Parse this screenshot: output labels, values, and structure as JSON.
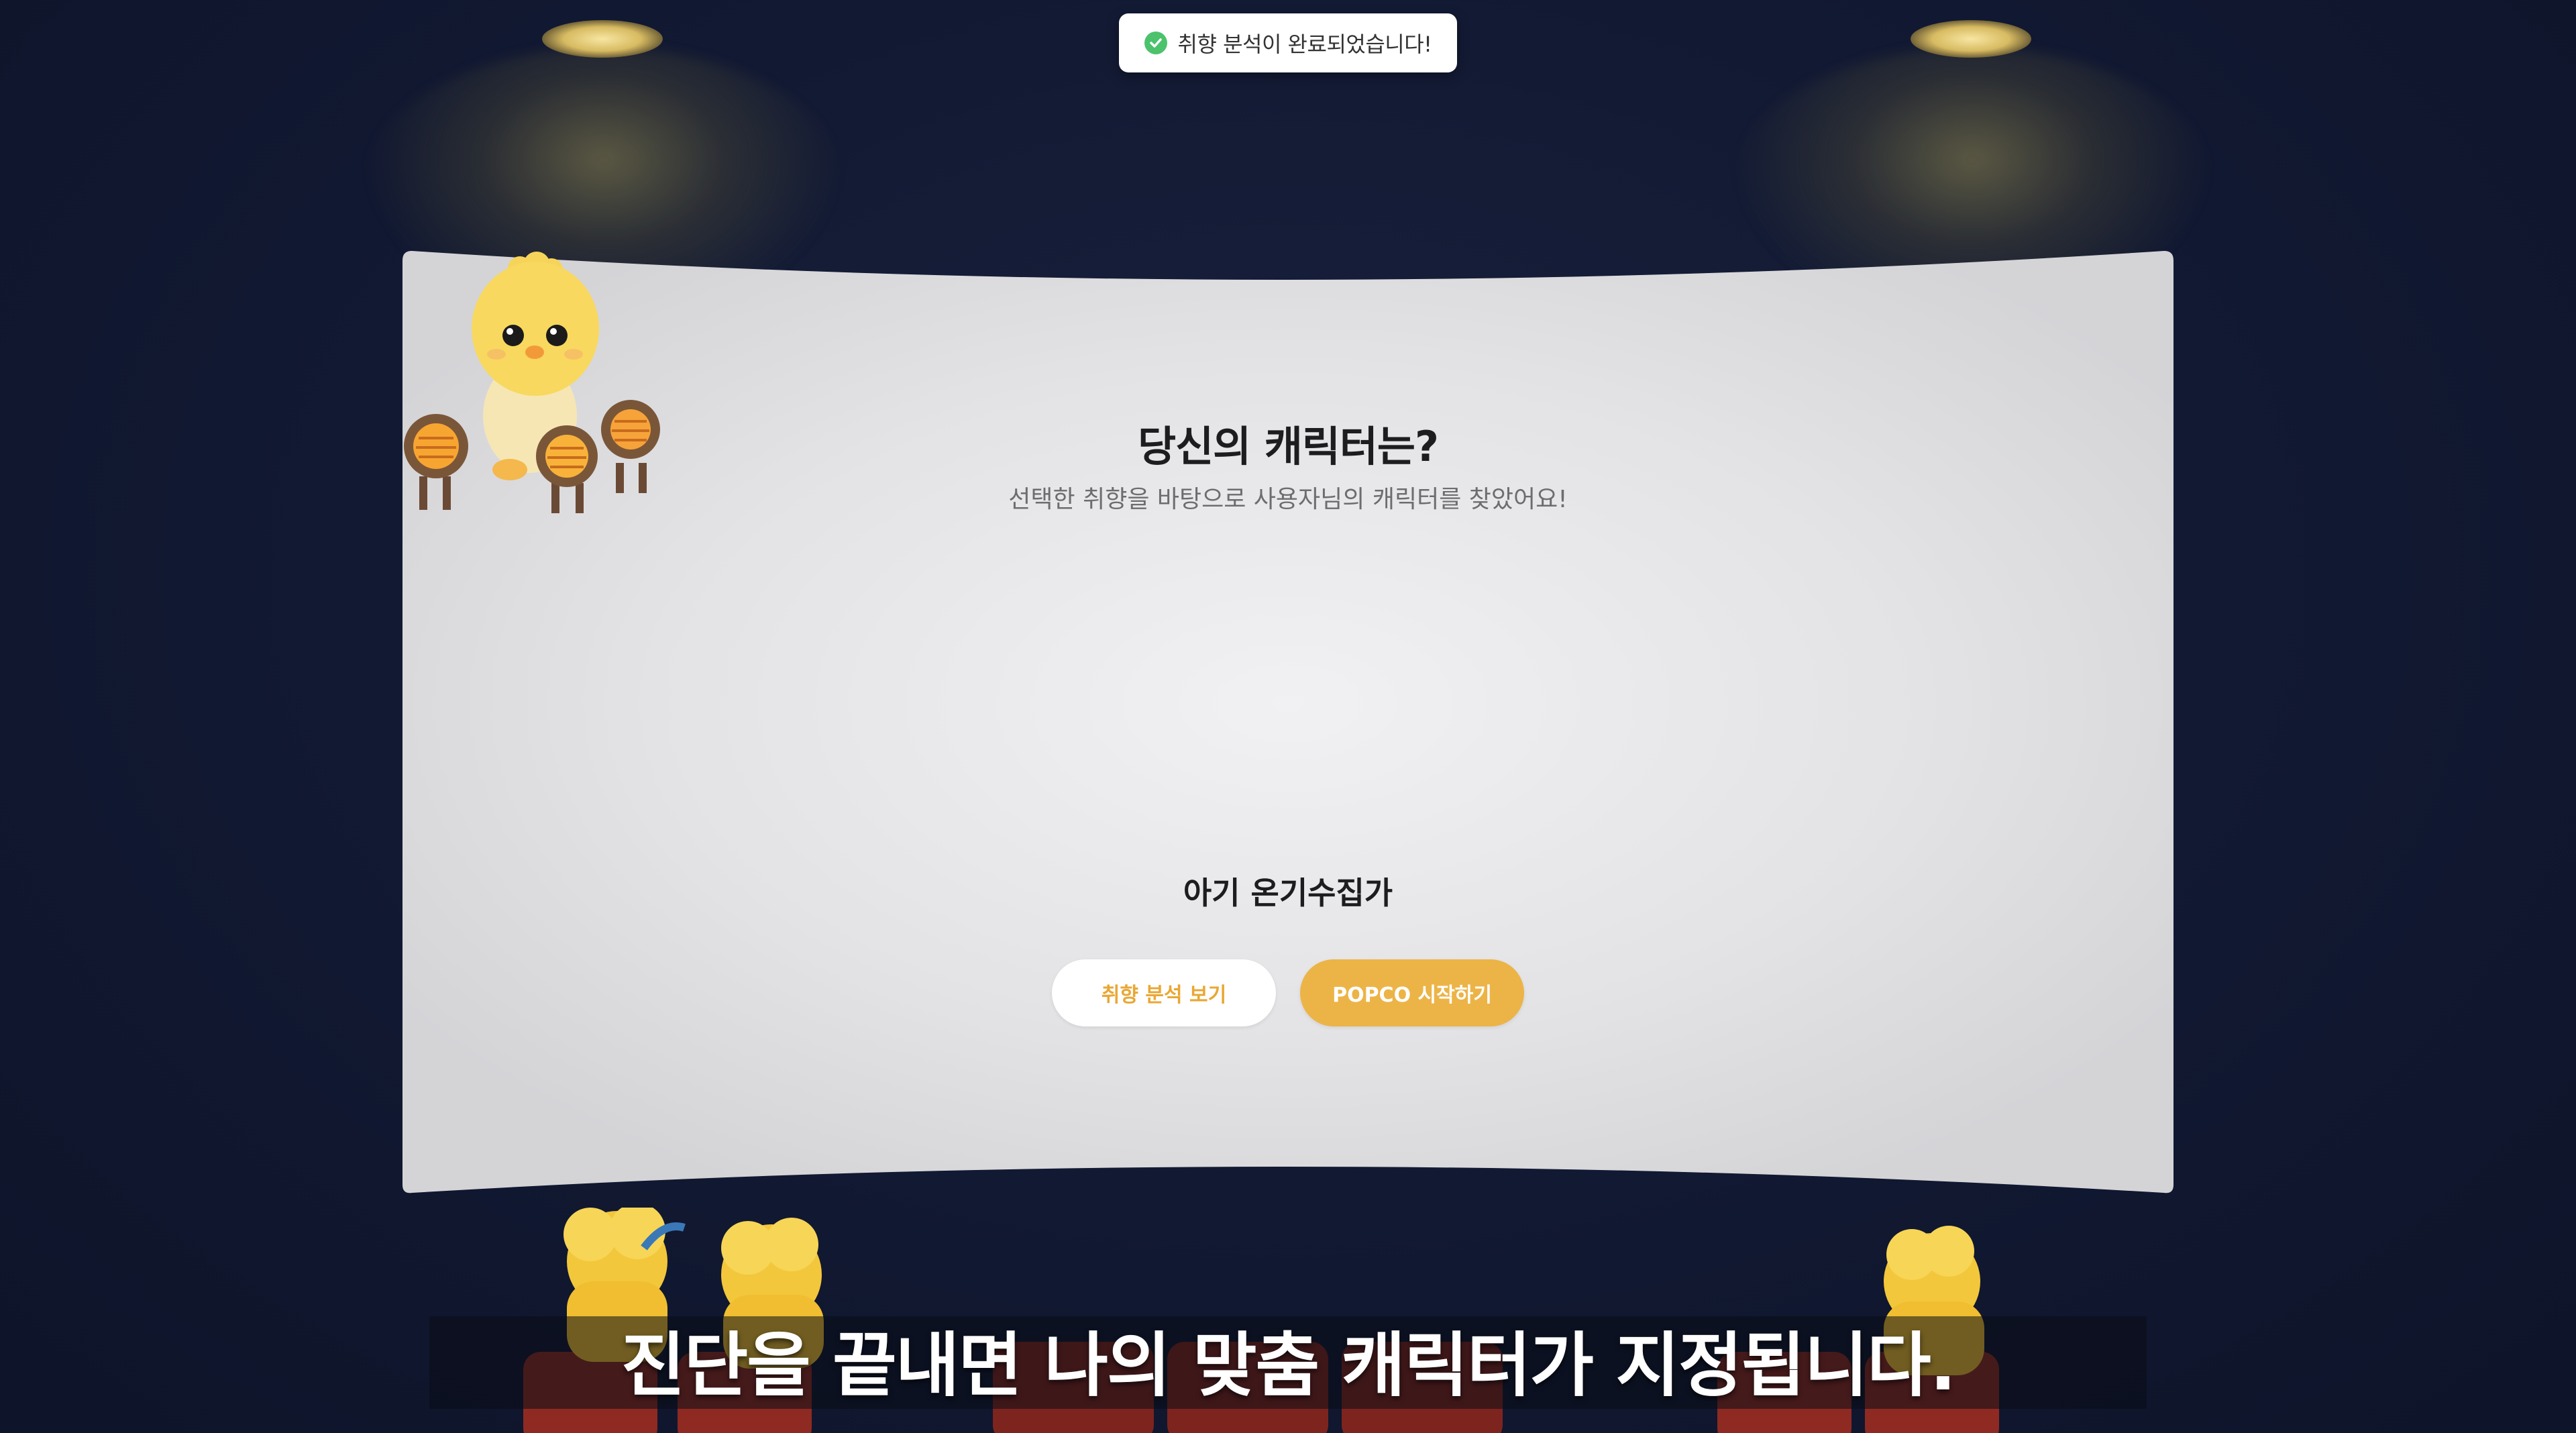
{
  "toast": {
    "message": "취향 분석이 완료되었습니다!",
    "icon": "check-circle-icon",
    "icon_color": "#4cc26d"
  },
  "result": {
    "title": "당신의 캐릭터는?",
    "subtitle": "선택한 취향을 바탕으로 사용자님의 캐릭터를 찾았어요!",
    "character_name": "아기 온기수집가"
  },
  "buttons": {
    "analysis_label": "취향 분석 보기",
    "start_label": "POPCO 시작하기"
  },
  "caption": {
    "text": "진단을 끝내면 나의 맞춤 캐릭터가 지정됩니다."
  },
  "colors": {
    "background": "#121a33",
    "accent": "#ecb447",
    "screen": "#e2e2e4"
  }
}
